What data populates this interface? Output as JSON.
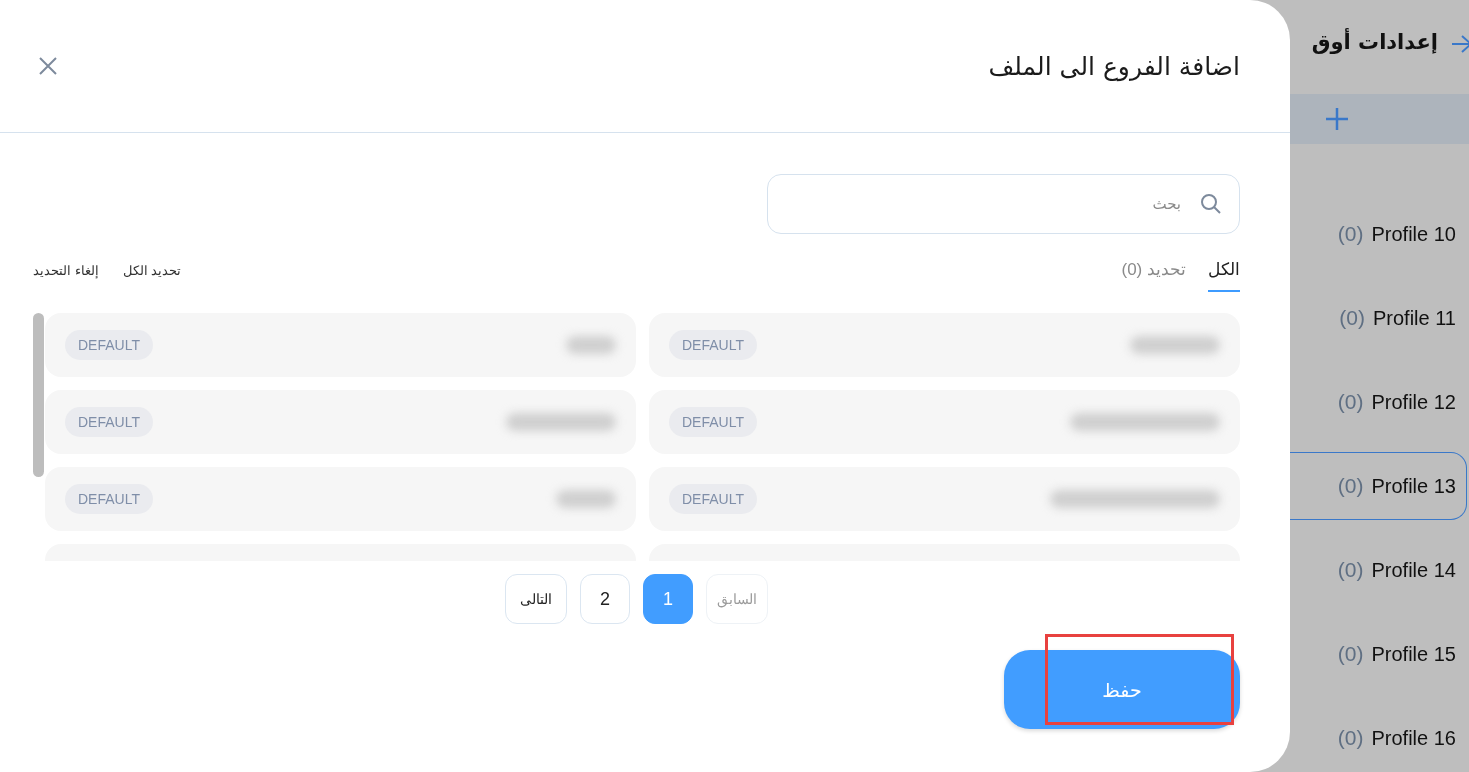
{
  "background": {
    "title": "إعدادات أوق",
    "profiles": [
      {
        "count": "(0)",
        "name": "Profile 10",
        "selected": false
      },
      {
        "count": "(0)",
        "name": "Profile 11",
        "selected": false
      },
      {
        "count": "(0)",
        "name": "Profile 12",
        "selected": false
      },
      {
        "count": "(0)",
        "name": "Profile 13",
        "selected": true
      },
      {
        "count": "(0)",
        "name": "Profile 14",
        "selected": false
      },
      {
        "count": "(0)",
        "name": "Profile 15",
        "selected": false
      },
      {
        "count": "(0)",
        "name": "Profile 16",
        "selected": false
      }
    ]
  },
  "dialog": {
    "title": "اضافة الفروع الى الملف",
    "search": {
      "placeholder": "بحث"
    },
    "tabs": [
      {
        "label": "الكل",
        "selected": true
      },
      {
        "label": "تحديد (0)",
        "selected": false
      }
    ],
    "actions": [
      "تحديد الكل",
      "إلغاء التحديد"
    ],
    "branches": [
      {
        "kind": "full",
        "tag": "DEFAULT"
      },
      {
        "kind": "full",
        "tag": "DEFAULT"
      },
      {
        "kind": "full",
        "tag": "DEFAULT"
      },
      {
        "kind": "full",
        "tag": "DEFAULT"
      },
      {
        "kind": "full",
        "tag": "DEFAULT"
      },
      {
        "kind": "full",
        "tag": "DEFAULT"
      },
      {
        "kind": "cut"
      },
      {
        "kind": "cut"
      }
    ],
    "pagination": [
      {
        "label": "السابق",
        "kind": "prev",
        "disabled": true,
        "selected": false
      },
      {
        "label": "1",
        "kind": "page",
        "disabled": false,
        "selected": true
      },
      {
        "label": "2",
        "kind": "page",
        "disabled": false,
        "selected": false
      },
      {
        "label": "التالى",
        "kind": "next",
        "disabled": false,
        "selected": false
      }
    ],
    "save_button": {
      "label": "حفظ",
      "highlighted": true
    }
  }
}
